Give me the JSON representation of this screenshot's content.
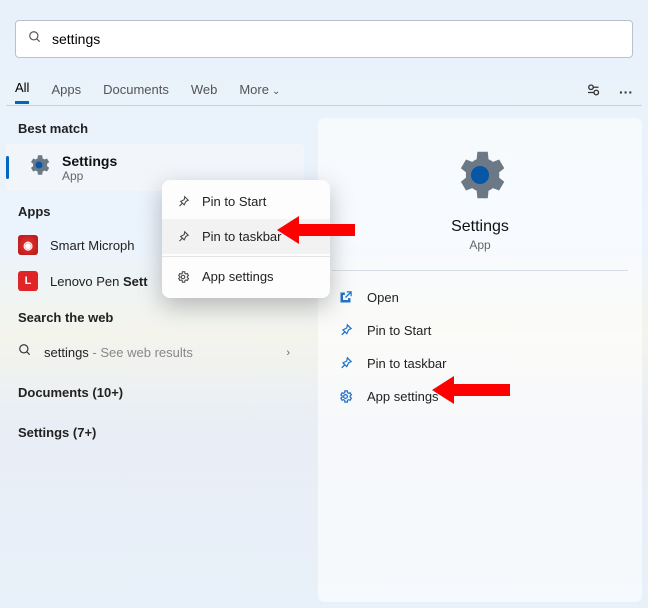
{
  "search": {
    "query": "settings"
  },
  "tabs": {
    "all": "All",
    "apps": "Apps",
    "documents": "Documents",
    "web": "Web",
    "more": "More"
  },
  "left": {
    "best_match_label": "Best match",
    "best_match": {
      "title": "Settings",
      "subtitle": "App"
    },
    "apps_label": "Apps",
    "app1_prefix": "Smart Microph",
    "app2_prefix": "Lenovo Pen ",
    "app2_highlight": "Sett",
    "web_label": "Search the web",
    "web_query": "settings",
    "web_suffix": " - See web results",
    "documents_label": "Documents (10+)",
    "settings_label": "Settings (7+)"
  },
  "context_menu": {
    "pin_start": "Pin to Start",
    "pin_taskbar": "Pin to taskbar",
    "app_settings": "App settings"
  },
  "right": {
    "title": "Settings",
    "subtitle": "App",
    "open": "Open",
    "pin_start": "Pin to Start",
    "pin_taskbar": "Pin to taskbar",
    "app_settings": "App settings"
  }
}
